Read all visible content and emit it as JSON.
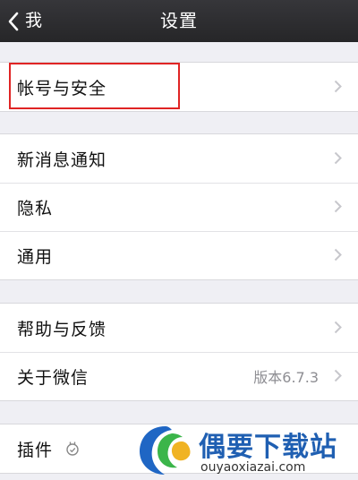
{
  "navbar": {
    "back_label": "我",
    "title": "设置"
  },
  "groups": [
    {
      "items": [
        {
          "label": "帐号与安全"
        }
      ]
    },
    {
      "items": [
        {
          "label": "新消息通知"
        },
        {
          "label": "隐私"
        },
        {
          "label": "通用"
        }
      ]
    },
    {
      "items": [
        {
          "label": "帮助与反馈"
        },
        {
          "label": "关于微信",
          "value": "版本6.7.3"
        }
      ]
    },
    {
      "items": [
        {
          "label": "插件"
        }
      ]
    }
  ],
  "highlight_color": "#e02424",
  "watermark": {
    "name": "偶要下载站",
    "url": "ouyaoxiazai.com"
  },
  "icons": [
    "chevron-left-icon",
    "chevron-right-icon",
    "plugin-icon",
    "watermark-logo-icon"
  ]
}
